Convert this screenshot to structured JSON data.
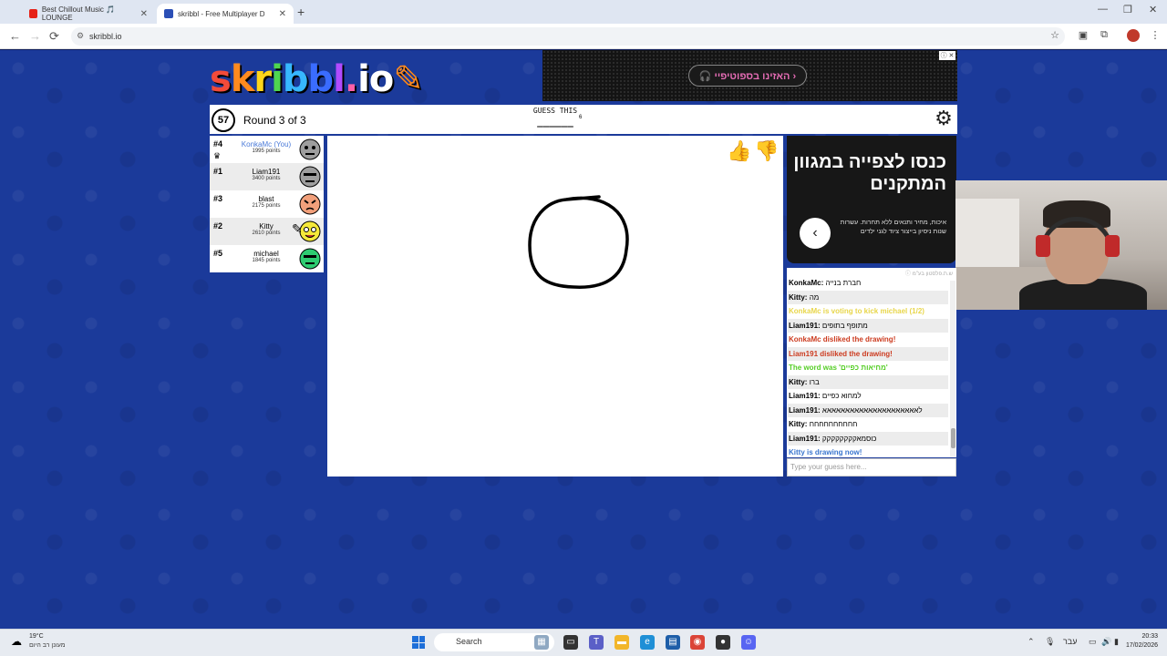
{
  "browser": {
    "tabs": [
      {
        "title": "Best Chillout Music 🎵 LOUNGE",
        "icon": "youtube-icon"
      },
      {
        "title": "skribbl - Free Multiplayer D",
        "icon": "skribbl-icon"
      }
    ],
    "url": "skribbl.io",
    "new_tab": "+",
    "back": "←",
    "forward": "→",
    "reload": "⟳"
  },
  "ad_top": {
    "button_text": "‹ האזינו בספוטיפיי 🎧",
    "close": "ⓘ ✕"
  },
  "logo": {
    "text": "skribbl.io"
  },
  "header": {
    "timer": "57",
    "round": "Round 3 of 3",
    "guess_label": "GUESS THIS",
    "guess_blanks": "______",
    "letter_count": "6"
  },
  "players": [
    {
      "rank": "#4",
      "name": "KonkaMc (You)",
      "points": "1995 points",
      "you": true,
      "avatar_color": "#9e9e9e"
    },
    {
      "rank": "#1",
      "name": "Liam191",
      "points": "3400 points",
      "you": false,
      "avatar_color": "#9e9e9e"
    },
    {
      "rank": "#3",
      "name": "blast",
      "points": "2175 points",
      "you": false,
      "avatar_color": "#f2a07b"
    },
    {
      "rank": "#2",
      "name": "Kitty",
      "points": "2610 points",
      "you": false,
      "avatar_color": "#f5e93a"
    },
    {
      "rank": "#5",
      "name": "michael",
      "points": "1845 points",
      "you": false,
      "avatar_color": "#2ecc71"
    }
  ],
  "ad_right": {
    "title": "כנסו לצפייה במגוון המתקנים",
    "text": "איכות, מחיר ותנאים ללא תחרות. עשרות שנות ניסיון בייצור ציוד לגני ילדים",
    "arrow": "‹"
  },
  "chat": {
    "ad_label": "ש.ת.פלסטון בע\"מ ⓘ",
    "messages": [
      {
        "user": "KonkaMc:",
        "text": "חברת בנייה",
        "color": "#000000"
      },
      {
        "user": "Kitty:",
        "text": "מה",
        "color": "#000000"
      },
      {
        "user": "",
        "text": "KonkaMc is voting to kick michael (1/2)",
        "color": "#e8d64a"
      },
      {
        "user": "Liam191:",
        "text": "מתופף בתופים",
        "color": "#000000"
      },
      {
        "user": "",
        "text": "KonkaMc disliked the drawing!",
        "color": "#cc3b1f"
      },
      {
        "user": "",
        "text": "Liam191 disliked the drawing!",
        "color": "#cc3b1f"
      },
      {
        "user": "",
        "text": "The word was 'מחיאות כפיים'",
        "color": "#56ce27"
      },
      {
        "user": "Kitty:",
        "text": "ברו",
        "color": "#000000"
      },
      {
        "user": "Liam191:",
        "text": "למחוא כפיים",
        "color": "#000000"
      },
      {
        "user": "Liam191:",
        "text": "לאאאאאאאאאאאאאאאאאאאאא",
        "color": "#000000"
      },
      {
        "user": "Kitty:",
        "text": "חחחחחחחחחח",
        "color": "#000000"
      },
      {
        "user": "Liam191:",
        "text": "כוסמאקקקקקקקק",
        "color": "#000000"
      },
      {
        "user": "",
        "text": "Kitty is drawing now!",
        "color": "#3975ce"
      }
    ],
    "input_placeholder": "Type your guess here..."
  },
  "taskbar": {
    "temperature": "19°C",
    "weather": "מעונן רב היום",
    "search": "Search",
    "time": "20:33",
    "date": "17/02/2026",
    "lang": "עבר"
  },
  "colors": {
    "page_bg": "#1b3a9a",
    "you_name": "#4a7ad8"
  }
}
